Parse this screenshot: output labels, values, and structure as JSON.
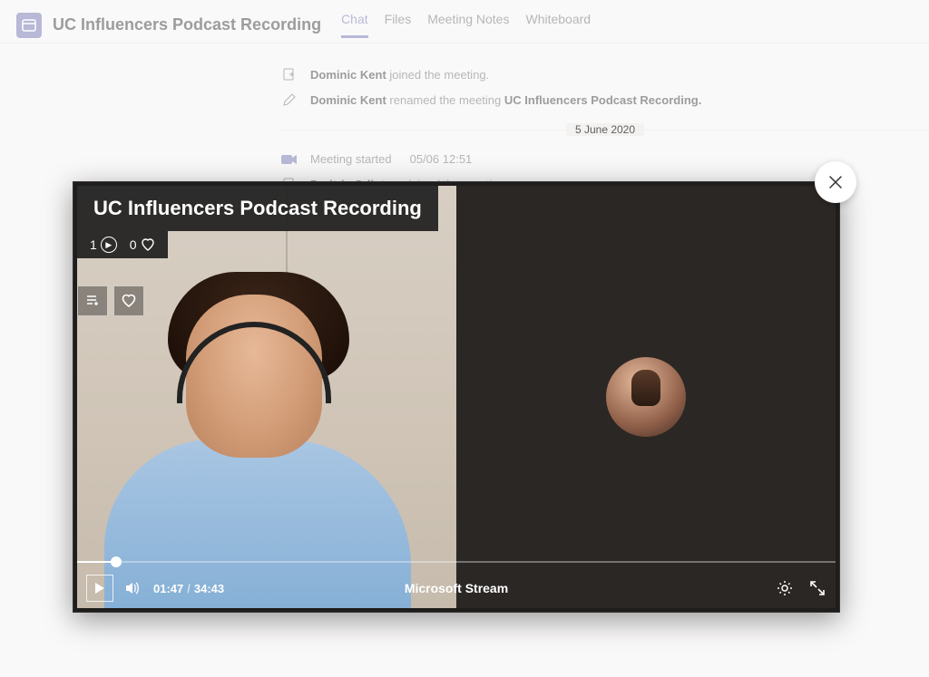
{
  "header": {
    "title": "UC Influencers Podcast Recording",
    "tabs": [
      "Chat",
      "Files",
      "Meeting Notes",
      "Whiteboard"
    ],
    "active_tab": 0
  },
  "feed": {
    "join1_name": "Dominic Kent",
    "join1_tail": " joined the meeting.",
    "rename_name": "Dominic Kent",
    "rename_mid": " renamed the meeting ",
    "rename_new": "UC Influencers Podcast Recording.",
    "divider_date": "5 June 2020",
    "started_label": "Meeting started",
    "started_time": "05/06 12:51",
    "join2_name": "Dmitriy Odintsov",
    "join2_tail": " joined the meeting."
  },
  "player": {
    "title": "UC Influencers Podcast Recording",
    "views": "1",
    "likes": "0",
    "current_time": "01:47",
    "duration": "34:43",
    "brand": "Microsoft Stream"
  }
}
